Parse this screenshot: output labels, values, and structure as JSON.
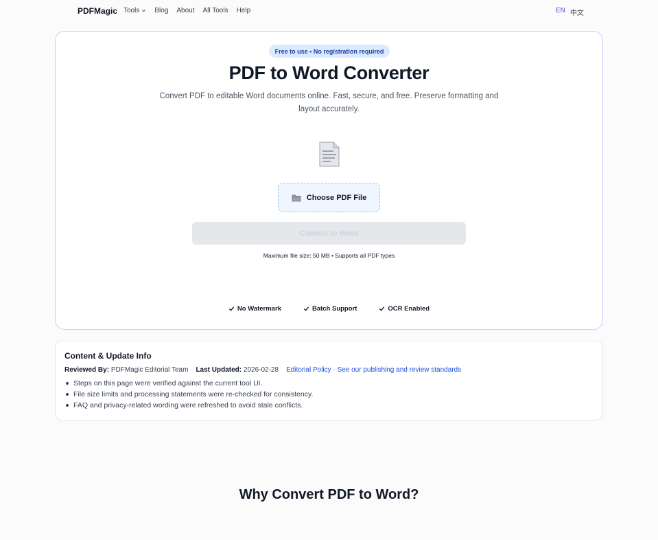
{
  "header": {
    "brand": "PDFMagic",
    "nav": [
      "Tools",
      "Blog",
      "About",
      "All Tools",
      "Help"
    ],
    "lang_en": "EN",
    "lang_zh": "中文"
  },
  "hero": {
    "badge": "Free to use • No registration required",
    "title": "PDF to Word Converter",
    "subtitle": "Convert PDF to editable Word documents online. Fast, secure, and free. Preserve formatting and layout accurately.",
    "choose_label": "Choose PDF File",
    "convert_label": "Convert to Word",
    "limits": "Maximum file size: 50 MB • Supports all PDF types",
    "features": [
      "No Watermark",
      "Batch Support",
      "OCR Enabled"
    ]
  },
  "info": {
    "title": "Content & Update Info",
    "reviewed_label": "Reviewed By:",
    "reviewed_value": "PDFMagic Editorial Team",
    "updated_label": "Last Updated:",
    "updated_value": "2026-02-28",
    "policy_link": "Editorial Policy · See our publishing and review standards",
    "items": [
      "Steps on this page were verified against the current tool UI.",
      "File size limits and processing statements were re-checked for consistency.",
      "FAQ and privacy-related wording were refreshed to avoid stale conflicts."
    ]
  },
  "section": {
    "why_title": "Why Convert PDF to Word?"
  },
  "colors": {
    "accent": "#4f46e5",
    "link": "#1d4ed8",
    "badge_bg": "#dbeafe",
    "hero_border": "#c7d2fe"
  },
  "icons": [
    "chevron-down-icon",
    "document-icon",
    "folder-icon",
    "check-icon"
  ]
}
